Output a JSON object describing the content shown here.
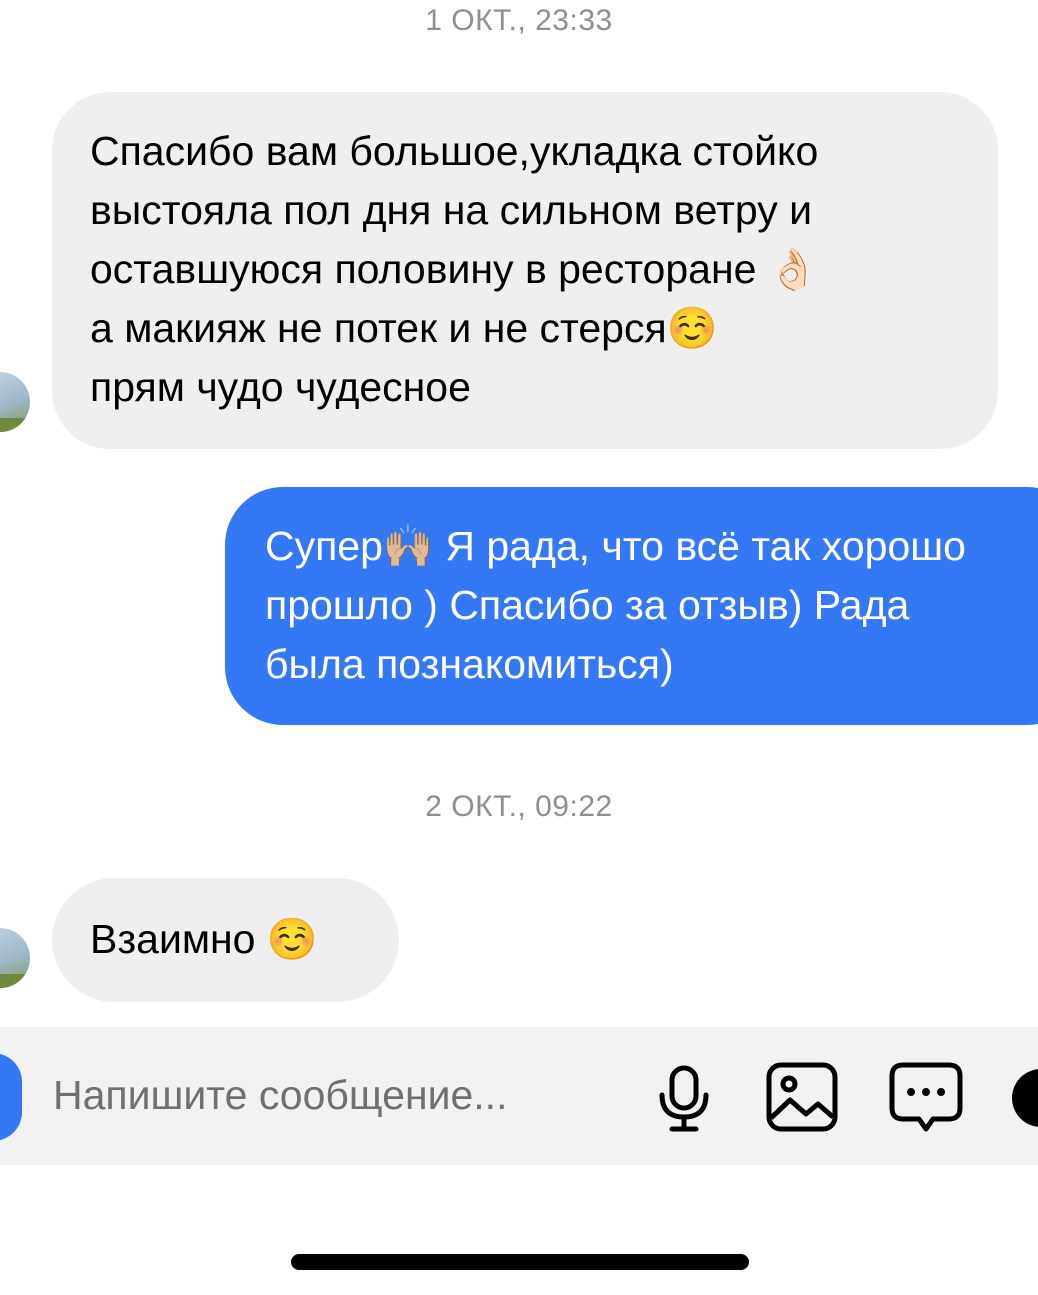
{
  "timestamps": {
    "first": "1 ОКТ., 23:33",
    "second": "2 ОКТ., 09:22"
  },
  "messages": [
    {
      "direction": "incoming",
      "text": "Спасибо вам большое,укладка стойко\nвыстояла пол дня на сильном ветру и\nоставшуюся половину в ресторане 👌🏻\nа макияж не потек и не стерся☺️\nпрям чудо чудесное"
    },
    {
      "direction": "outgoing",
      "text": "Супер🙌🏼 Я рада, что всё так хорошо\nпрошло ) Спасибо за отзыв) Рада\nбыла познакомиться)"
    },
    {
      "direction": "incoming",
      "text": "Взаимно ☺️"
    }
  ],
  "composer": {
    "placeholder": "Напишите сообщение..."
  },
  "icons": {
    "camera": "camera-icon",
    "mic": "microphone-icon",
    "gallery": "image-icon",
    "sticker": "chat-bubble-icon",
    "more": "plus-icon"
  },
  "colors": {
    "outgoing_bubble": "#3478f6",
    "incoming_bubble": "#efefef",
    "timestamp": "#8e8e93",
    "composer_bg": "#f2f2f2"
  }
}
